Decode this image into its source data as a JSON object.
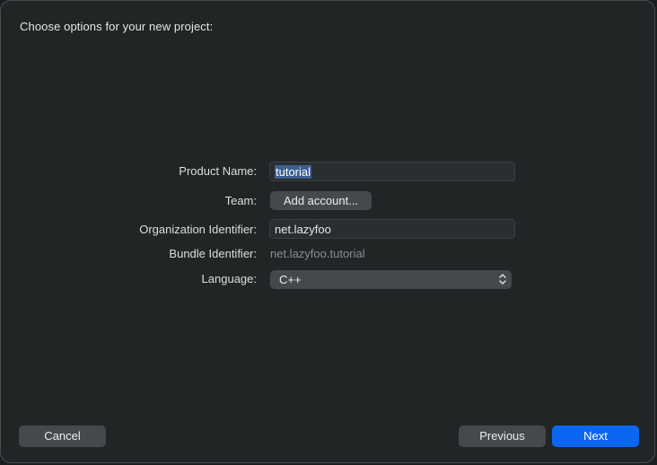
{
  "dialog": {
    "title": "Choose options for your new project:"
  },
  "form": {
    "product_name": {
      "label": "Product Name:",
      "value": "tutorial"
    },
    "team": {
      "label": "Team:",
      "button_label": "Add account..."
    },
    "organization_identifier": {
      "label": "Organization Identifier:",
      "value": "net.lazyfoo"
    },
    "bundle_identifier": {
      "label": "Bundle Identifier:",
      "value": "net.lazyfoo.tutorial"
    },
    "language": {
      "label": "Language:",
      "selected": "C++",
      "icon": "chevron-up-down-icon"
    }
  },
  "footer": {
    "cancel_label": "Cancel",
    "previous_label": "Previous",
    "next_label": "Next"
  },
  "colors": {
    "background": "#212526",
    "accent": "#0a67f0",
    "selection": "#3b5f92",
    "button": "#46494b"
  }
}
